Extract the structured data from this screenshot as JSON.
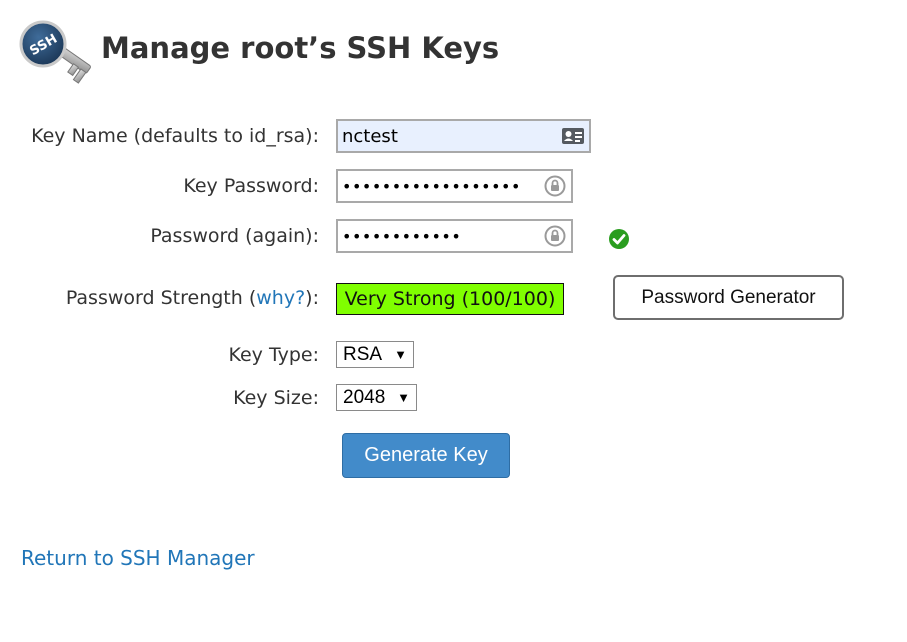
{
  "header": {
    "logo_icon": "ssh-key-icon",
    "logo_text": "SSH",
    "title": "Manage root’s SSH Keys"
  },
  "form": {
    "key_name": {
      "label": "Key Name (defaults to id_rsa):",
      "value": "nctest",
      "icon": "contact-card-icon"
    },
    "key_password": {
      "label": "Key Password:",
      "value": "••••••••••••••••••",
      "icon": "lock-icon"
    },
    "password_again": {
      "label": "Password (again):",
      "value": "••••••••••••",
      "icon": "lock-icon",
      "match_icon": "green-check-icon"
    },
    "strength": {
      "label_prefix": "Password Strength (",
      "help_link": "why?",
      "label_suffix": "):",
      "value": "Very Strong (100/100)",
      "color": "#80ff00"
    },
    "password_generator_label": "Password Generator",
    "key_type": {
      "label": "Key Type:",
      "selected": "RSA"
    },
    "key_size": {
      "label": "Key Size:",
      "selected": "2048"
    },
    "generate_label": "Generate Key"
  },
  "footer": {
    "return_link": "Return to SSH Manager"
  },
  "colors": {
    "link": "#2176b8",
    "primary_button": "#428bca",
    "key_name_bg": "#e8f0fe",
    "check": "#2a9d1f"
  }
}
